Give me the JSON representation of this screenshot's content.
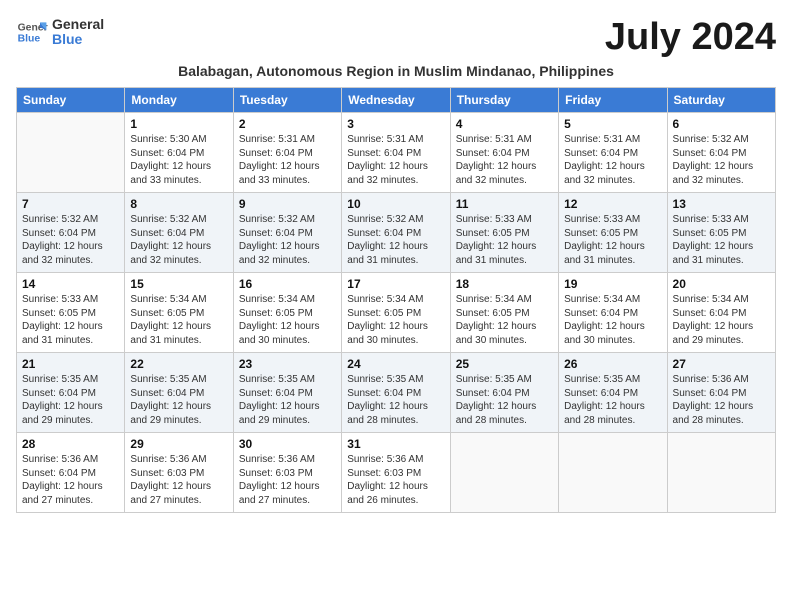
{
  "logo": {
    "line1": "General",
    "line2": "Blue"
  },
  "title": "July 2024",
  "subtitle": "Balabagan, Autonomous Region in Muslim Mindanao, Philippines",
  "days_of_week": [
    "Sunday",
    "Monday",
    "Tuesday",
    "Wednesday",
    "Thursday",
    "Friday",
    "Saturday"
  ],
  "weeks": [
    [
      {
        "day": "",
        "info": ""
      },
      {
        "day": "1",
        "info": "Sunrise: 5:30 AM\nSunset: 6:04 PM\nDaylight: 12 hours\nand 33 minutes."
      },
      {
        "day": "2",
        "info": "Sunrise: 5:31 AM\nSunset: 6:04 PM\nDaylight: 12 hours\nand 33 minutes."
      },
      {
        "day": "3",
        "info": "Sunrise: 5:31 AM\nSunset: 6:04 PM\nDaylight: 12 hours\nand 32 minutes."
      },
      {
        "day": "4",
        "info": "Sunrise: 5:31 AM\nSunset: 6:04 PM\nDaylight: 12 hours\nand 32 minutes."
      },
      {
        "day": "5",
        "info": "Sunrise: 5:31 AM\nSunset: 6:04 PM\nDaylight: 12 hours\nand 32 minutes."
      },
      {
        "day": "6",
        "info": "Sunrise: 5:32 AM\nSunset: 6:04 PM\nDaylight: 12 hours\nand 32 minutes."
      }
    ],
    [
      {
        "day": "7",
        "info": "Sunrise: 5:32 AM\nSunset: 6:04 PM\nDaylight: 12 hours\nand 32 minutes."
      },
      {
        "day": "8",
        "info": "Sunrise: 5:32 AM\nSunset: 6:04 PM\nDaylight: 12 hours\nand 32 minutes."
      },
      {
        "day": "9",
        "info": "Sunrise: 5:32 AM\nSunset: 6:04 PM\nDaylight: 12 hours\nand 32 minutes."
      },
      {
        "day": "10",
        "info": "Sunrise: 5:32 AM\nSunset: 6:04 PM\nDaylight: 12 hours\nand 31 minutes."
      },
      {
        "day": "11",
        "info": "Sunrise: 5:33 AM\nSunset: 6:05 PM\nDaylight: 12 hours\nand 31 minutes."
      },
      {
        "day": "12",
        "info": "Sunrise: 5:33 AM\nSunset: 6:05 PM\nDaylight: 12 hours\nand 31 minutes."
      },
      {
        "day": "13",
        "info": "Sunrise: 5:33 AM\nSunset: 6:05 PM\nDaylight: 12 hours\nand 31 minutes."
      }
    ],
    [
      {
        "day": "14",
        "info": "Sunrise: 5:33 AM\nSunset: 6:05 PM\nDaylight: 12 hours\nand 31 minutes."
      },
      {
        "day": "15",
        "info": "Sunrise: 5:34 AM\nSunset: 6:05 PM\nDaylight: 12 hours\nand 31 minutes."
      },
      {
        "day": "16",
        "info": "Sunrise: 5:34 AM\nSunset: 6:05 PM\nDaylight: 12 hours\nand 30 minutes."
      },
      {
        "day": "17",
        "info": "Sunrise: 5:34 AM\nSunset: 6:05 PM\nDaylight: 12 hours\nand 30 minutes."
      },
      {
        "day": "18",
        "info": "Sunrise: 5:34 AM\nSunset: 6:05 PM\nDaylight: 12 hours\nand 30 minutes."
      },
      {
        "day": "19",
        "info": "Sunrise: 5:34 AM\nSunset: 6:04 PM\nDaylight: 12 hours\nand 30 minutes."
      },
      {
        "day": "20",
        "info": "Sunrise: 5:34 AM\nSunset: 6:04 PM\nDaylight: 12 hours\nand 29 minutes."
      }
    ],
    [
      {
        "day": "21",
        "info": "Sunrise: 5:35 AM\nSunset: 6:04 PM\nDaylight: 12 hours\nand 29 minutes."
      },
      {
        "day": "22",
        "info": "Sunrise: 5:35 AM\nSunset: 6:04 PM\nDaylight: 12 hours\nand 29 minutes."
      },
      {
        "day": "23",
        "info": "Sunrise: 5:35 AM\nSunset: 6:04 PM\nDaylight: 12 hours\nand 29 minutes."
      },
      {
        "day": "24",
        "info": "Sunrise: 5:35 AM\nSunset: 6:04 PM\nDaylight: 12 hours\nand 28 minutes."
      },
      {
        "day": "25",
        "info": "Sunrise: 5:35 AM\nSunset: 6:04 PM\nDaylight: 12 hours\nand 28 minutes."
      },
      {
        "day": "26",
        "info": "Sunrise: 5:35 AM\nSunset: 6:04 PM\nDaylight: 12 hours\nand 28 minutes."
      },
      {
        "day": "27",
        "info": "Sunrise: 5:36 AM\nSunset: 6:04 PM\nDaylight: 12 hours\nand 28 minutes."
      }
    ],
    [
      {
        "day": "28",
        "info": "Sunrise: 5:36 AM\nSunset: 6:04 PM\nDaylight: 12 hours\nand 27 minutes."
      },
      {
        "day": "29",
        "info": "Sunrise: 5:36 AM\nSunset: 6:03 PM\nDaylight: 12 hours\nand 27 minutes."
      },
      {
        "day": "30",
        "info": "Sunrise: 5:36 AM\nSunset: 6:03 PM\nDaylight: 12 hours\nand 27 minutes."
      },
      {
        "day": "31",
        "info": "Sunrise: 5:36 AM\nSunset: 6:03 PM\nDaylight: 12 hours\nand 26 minutes."
      },
      {
        "day": "",
        "info": ""
      },
      {
        "day": "",
        "info": ""
      },
      {
        "day": "",
        "info": ""
      }
    ]
  ]
}
